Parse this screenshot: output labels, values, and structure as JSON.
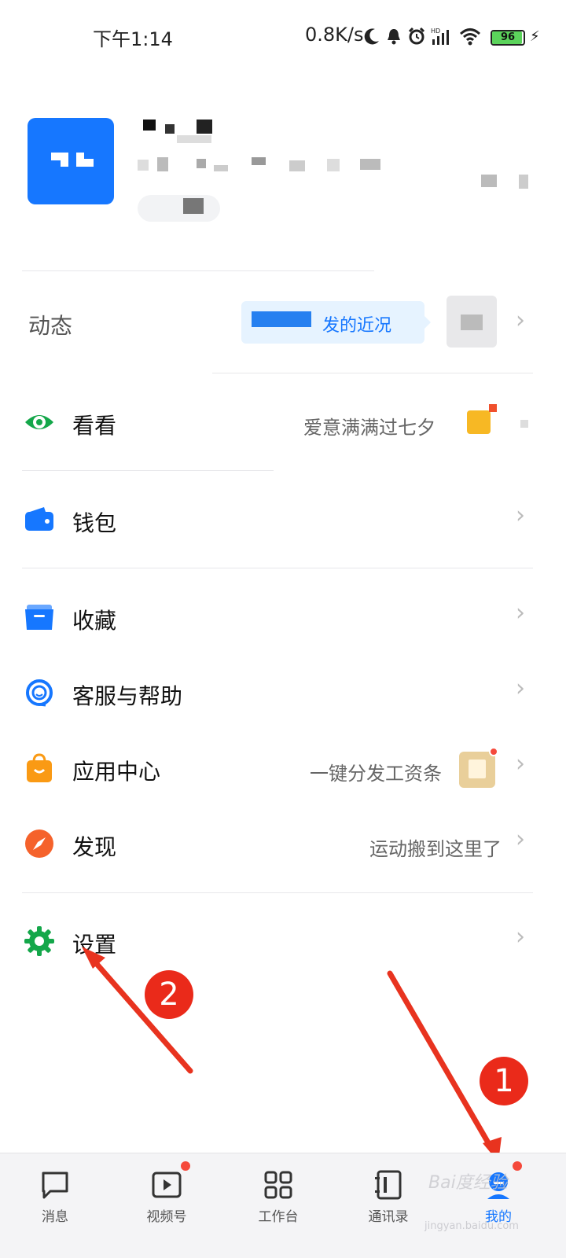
{
  "status_bar": {
    "time": "下午1:14",
    "net_speed": "0.8K/s",
    "battery": "96",
    "battery_level": 0.96
  },
  "moments": {
    "label": "动态",
    "bubble_text": "发的近况"
  },
  "menu": [
    {
      "id": "look",
      "label": "看看",
      "sub": "爱意满满过七夕",
      "icon": "eye-icon",
      "color": "#14a74a"
    },
    {
      "id": "wallet",
      "label": "钱包",
      "sub": "",
      "icon": "wallet-icon",
      "color": "#1677ff"
    },
    {
      "id": "favorites",
      "label": "收藏",
      "sub": "",
      "icon": "folder-icon",
      "color": "#1677ff"
    },
    {
      "id": "support",
      "label": "客服与帮助",
      "sub": "",
      "icon": "headset-icon",
      "color": "#1677ff"
    },
    {
      "id": "apps",
      "label": "应用中心",
      "sub": "一键分发工资条",
      "icon": "shopping-bag-icon",
      "color": "#fa9a14"
    },
    {
      "id": "discover",
      "label": "发现",
      "sub": "运动搬到这里了",
      "icon": "compass-icon",
      "color": "#f5622b"
    },
    {
      "id": "settings",
      "label": "设置",
      "sub": "",
      "icon": "gear-icon",
      "color": "#14a74a"
    }
  ],
  "tabs": [
    {
      "label": "消息",
      "icon": "chat-bubble-icon",
      "dot": false
    },
    {
      "label": "视频号",
      "icon": "video-play-icon",
      "dot": true
    },
    {
      "label": "工作台",
      "icon": "grid-icon",
      "dot": false
    },
    {
      "label": "通讯录",
      "icon": "contacts-book-icon",
      "dot": false
    },
    {
      "label": "我的",
      "icon": "profile-icon",
      "dot": true
    }
  ],
  "annotations": {
    "step1": "1",
    "step2": "2"
  },
  "watermark": {
    "text": "Bai度经验",
    "sub": "jingyan.baidu.com"
  }
}
